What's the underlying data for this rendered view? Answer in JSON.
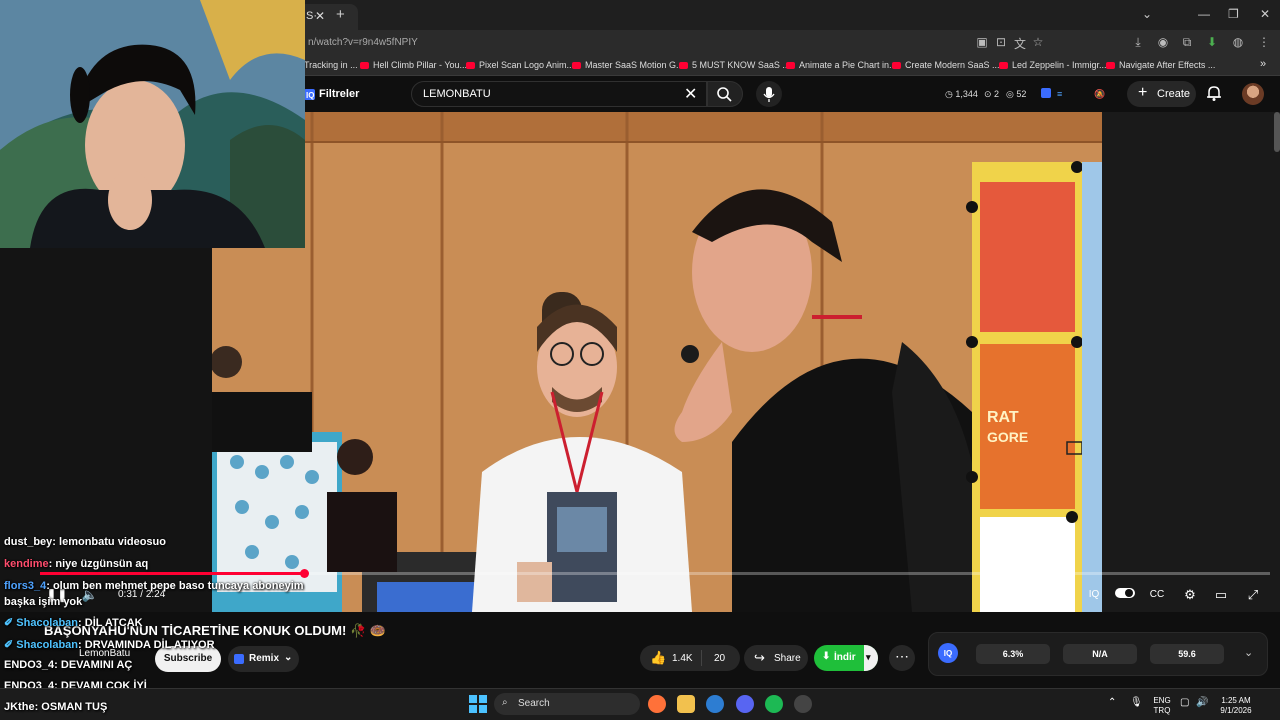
{
  "browser": {
    "tab_label": "S·",
    "tab_close": "✕",
    "new_tab": "+",
    "url": "n/watch?v=r9n4w5fNPIY",
    "window_controls": [
      "⌄",
      "—",
      "❐",
      "✕"
    ],
    "bookmarks": [
      "Tracking in ...",
      "Hell Climb Pillar - You...",
      "Pixel Scan Logo Anim...",
      "Master SaaS Motion G...",
      "5 MUST KNOW SaaS ...",
      "Animate a Pie Chart in...",
      "Create Modern SaaS ...",
      "Led Zeppelin - Immigr...",
      "Navigate After Effects ..."
    ],
    "more_bookmarks": "»"
  },
  "youtube": {
    "filters_label": "Filtreler",
    "search_value": "LEMONBATU",
    "stats": {
      "views": "1,344",
      "likes": "2",
      "watch": "52"
    },
    "create_label": "Create"
  },
  "player": {
    "time_current": "0:31",
    "time_total": "2:24",
    "progress": 0.215
  },
  "video": {
    "title": "BAŞONYAHU'NUN TİCARETİNE KONUK OLDUM! 🥀 🍩",
    "channel": "LemonBatu",
    "subscribe_label": "Subscribe",
    "remix_label": "Remix",
    "likes": "1.4K",
    "dislikes": "20",
    "share_label": "Share",
    "download_label": "İndir"
  },
  "stats_panel": {
    "a": "6.3%",
    "b": "N/A",
    "c": "59.6",
    "iq_label": "IQ"
  },
  "chat": [
    {
      "user": "dust_bey",
      "msg": "lemonbatu videosuo",
      "color": "#ffffff"
    },
    {
      "user": "kendime",
      "msg": "niye üzgünsün aq",
      "color": "#ff4d6d"
    },
    {
      "user": "flors3_4",
      "msg": "olum ben mehmet pepe baso tuncaya aboneyim",
      "color": "#4fa3ff"
    },
    {
      "user": "",
      "msg": "başka işim yok",
      "color": "#ffffff"
    },
    {
      "user": "Shacolaban",
      "msg": "DİL ATCAK",
      "color": "#4fc3ff"
    },
    {
      "user": "Shacolaban",
      "msg": "DRVAMINDA DİL ATIYOR",
      "color": "#4fc3ff"
    },
    {
      "user": "ENDO3_4",
      "msg": "DEVAMINI AÇ",
      "color": "#ffffff"
    },
    {
      "user": "ENDO3_4",
      "msg": "DEVAMI ÇOK İYİ",
      "color": "#ffffff"
    },
    {
      "user": "JKthe",
      "msg": "OSMAN TUŞ",
      "color": "#ffffff"
    }
  ],
  "taskbar": {
    "search_label": "Search",
    "lang": "ENG",
    "lang2": "TRQ",
    "time": "1:25 AM",
    "date": "9/1/2026"
  },
  "colors": {
    "accent": "#ff0033",
    "download": "#1fbf3a",
    "bg": "#0f0f0f"
  }
}
